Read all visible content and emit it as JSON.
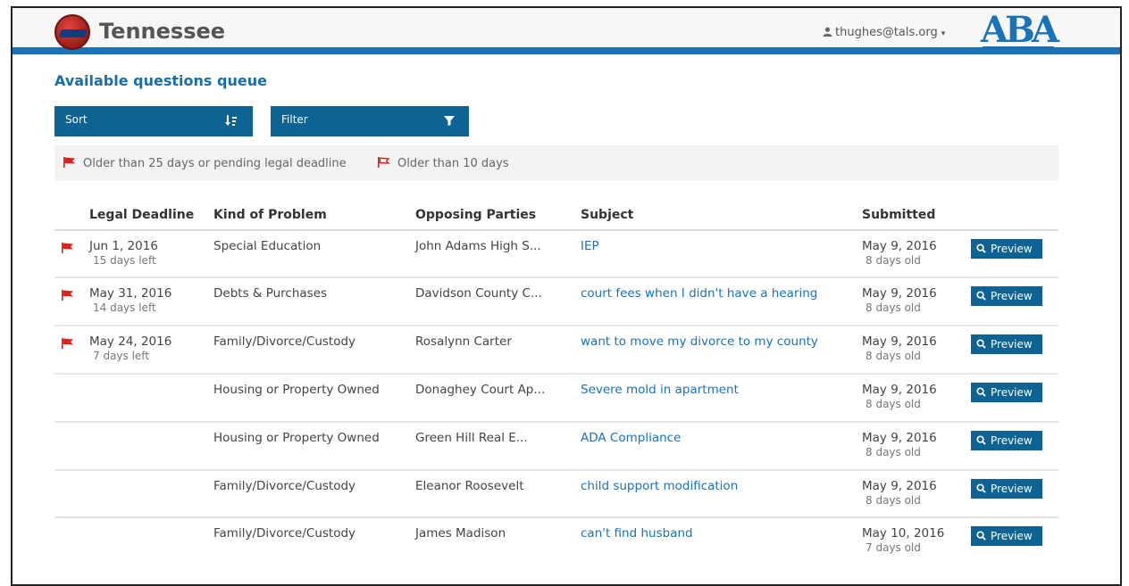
{
  "header": {
    "brand": "Tennessee",
    "user_email": "thughes@tals.org",
    "aba_text": "ABA"
  },
  "page_title": "Available questions queue",
  "controls": {
    "sort_label": "Sort",
    "filter_label": "Filter"
  },
  "legend": {
    "urgent_label": "Older than 25 days or pending legal deadline",
    "older_label": "Older than 10 days"
  },
  "colors": {
    "accent": "#0d6394",
    "flag": "#e0211b",
    "link": "#1a73b8"
  },
  "table": {
    "columns": [
      "Legal Deadline",
      "Kind of Problem",
      "Opposing Parties",
      "Subject",
      "Submitted"
    ],
    "preview_label": "Preview",
    "rows": [
      {
        "flag": true,
        "deadline": "Jun 1, 2016",
        "deadline_sub": "15 days left",
        "kind": "Special Education",
        "parties": "John Adams High S...",
        "subject": "IEP",
        "submitted": "May 9, 2016",
        "submitted_sub": "8 days old"
      },
      {
        "flag": true,
        "deadline": "May 31, 2016",
        "deadline_sub": "14 days left",
        "kind": "Debts & Purchases",
        "parties": "Davidson County C...",
        "subject": "court fees when I didn't have a hearing",
        "submitted": "May 9, 2016",
        "submitted_sub": "8 days old"
      },
      {
        "flag": true,
        "deadline": "May 24, 2016",
        "deadline_sub": "7 days left",
        "kind": "Family/Divorce/Custody",
        "parties": "Rosalynn Carter",
        "subject": "want to move my divorce to my county",
        "submitted": "May 9, 2016",
        "submitted_sub": "8 days old"
      },
      {
        "flag": false,
        "deadline": "",
        "deadline_sub": "",
        "kind": "Housing or Property Owned",
        "parties": "Donaghey Court Ap...",
        "subject": "Severe mold in apartment",
        "submitted": "May 9, 2016",
        "submitted_sub": "8 days old"
      },
      {
        "flag": false,
        "deadline": "",
        "deadline_sub": "",
        "kind": "Housing or Property Owned",
        "parties": "Green Hill Real E...",
        "subject": "ADA Compliance",
        "submitted": "May 9, 2016",
        "submitted_sub": "8 days old"
      },
      {
        "flag": false,
        "deadline": "",
        "deadline_sub": "",
        "kind": "Family/Divorce/Custody",
        "parties": "Eleanor Roosevelt",
        "subject": "child support modification",
        "submitted": "May 9, 2016",
        "submitted_sub": "8 days old"
      },
      {
        "flag": false,
        "deadline": "",
        "deadline_sub": "",
        "kind": "Family/Divorce/Custody",
        "parties": "James Madison",
        "subject": "can't find husband",
        "submitted": "May 10, 2016",
        "submitted_sub": "7 days old"
      }
    ]
  }
}
